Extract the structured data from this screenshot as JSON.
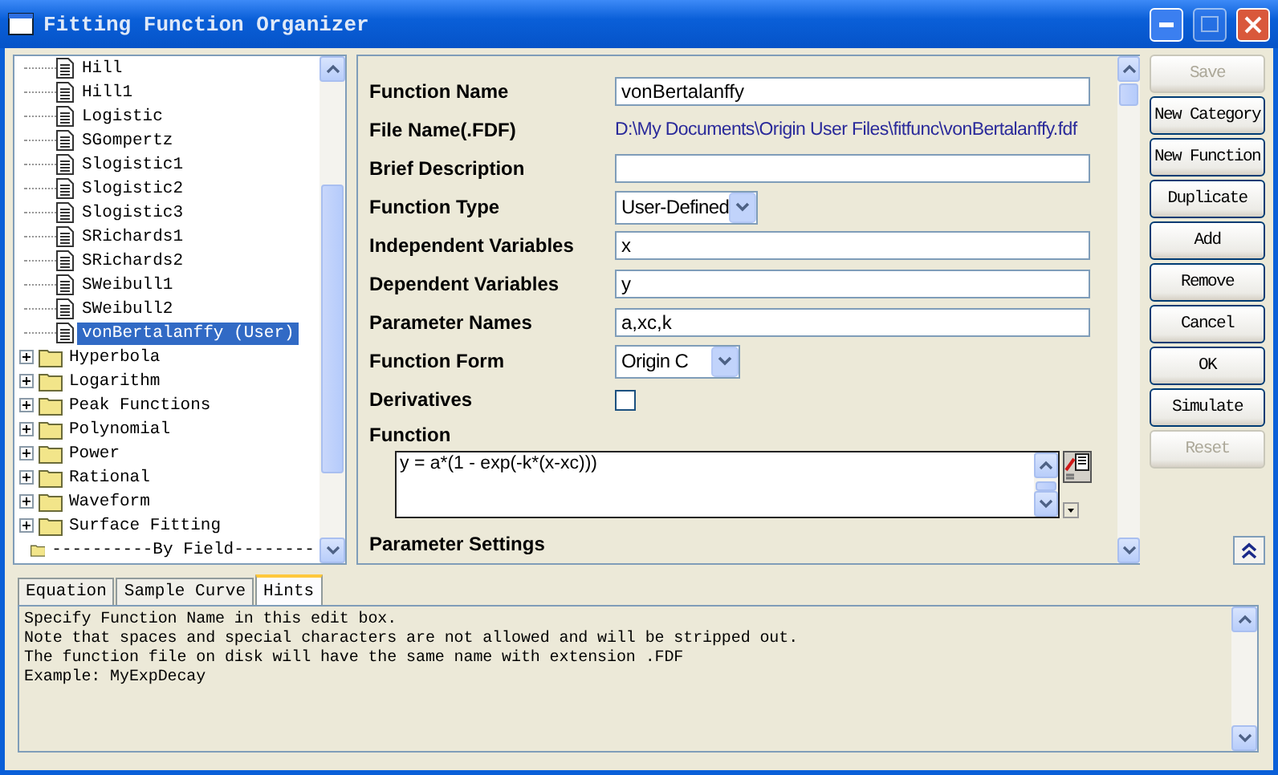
{
  "window": {
    "title": "Fitting Function Organizer"
  },
  "tree": [
    {
      "kind": "file",
      "label": "Hill",
      "selected": false
    },
    {
      "kind": "file",
      "label": "Hill1",
      "selected": false
    },
    {
      "kind": "file",
      "label": "Logistic",
      "selected": false
    },
    {
      "kind": "file",
      "label": "SGompertz",
      "selected": false
    },
    {
      "kind": "file",
      "label": "Slogistic1",
      "selected": false
    },
    {
      "kind": "file",
      "label": "Slogistic2",
      "selected": false
    },
    {
      "kind": "file",
      "label": "Slogistic3",
      "selected": false
    },
    {
      "kind": "file",
      "label": "SRichards1",
      "selected": false
    },
    {
      "kind": "file",
      "label": "SRichards2",
      "selected": false
    },
    {
      "kind": "file",
      "label": "SWeibull1",
      "selected": false
    },
    {
      "kind": "file",
      "label": "SWeibull2",
      "selected": false
    },
    {
      "kind": "file",
      "label": "vonBertalanffy (User)",
      "selected": true
    },
    {
      "kind": "folder",
      "label": "Hyperbola",
      "expanded": false,
      "selected": false
    },
    {
      "kind": "folder",
      "label": "Logarithm",
      "expanded": false,
      "selected": false
    },
    {
      "kind": "folder",
      "label": "Peak Functions",
      "expanded": false,
      "selected": false
    },
    {
      "kind": "folder",
      "label": "Polynomial",
      "expanded": false,
      "selected": false
    },
    {
      "kind": "folder",
      "label": "Power",
      "expanded": false,
      "selected": false
    },
    {
      "kind": "folder",
      "label": "Rational",
      "expanded": false,
      "selected": false
    },
    {
      "kind": "folder",
      "label": "Waveform",
      "expanded": false,
      "selected": false
    },
    {
      "kind": "folder",
      "label": "Surface Fitting",
      "expanded": false,
      "selected": false
    },
    {
      "kind": "separator",
      "label": "----------By Field--------",
      "selected": false
    }
  ],
  "form": [
    {
      "kind": "text",
      "label": "Function Name",
      "value": "vonBertalanffy"
    },
    {
      "kind": "path",
      "label": "File Name(.FDF)",
      "value": "D:\\My Documents\\Origin User Files\\fitfunc\\vonBertalanffy.fdf"
    },
    {
      "kind": "text",
      "label": "Brief Description"
    },
    {
      "kind": "select",
      "label": "Function Type",
      "value": "User-Defined"
    },
    {
      "kind": "text",
      "label": "Independent Variables",
      "value": "x"
    },
    {
      "kind": "text",
      "label": "Dependent Variables",
      "value": "y"
    },
    {
      "kind": "text",
      "label": "Parameter Names",
      "value": "a,xc,k"
    },
    {
      "kind": "select",
      "label": "Function Form",
      "value": "Origin C"
    },
    {
      "kind": "checkbox",
      "label": "Derivatives",
      "checked": false
    },
    {
      "kind": "code",
      "label": "Function",
      "value": "y = a*(1 - exp(-k*(x-xc)))"
    },
    {
      "kind": "heading",
      "label": "Parameter Settings"
    }
  ],
  "buttons": [
    {
      "label": "Save",
      "disabled": true
    },
    {
      "label": "New Category",
      "disabled": false
    },
    {
      "label": "New Function",
      "disabled": false
    },
    {
      "label": "Duplicate",
      "disabled": false
    },
    {
      "label": "Add",
      "disabled": false
    },
    {
      "label": "Remove",
      "disabled": false
    },
    {
      "label": "Cancel",
      "disabled": false
    },
    {
      "label": "OK",
      "disabled": false
    },
    {
      "label": "Simulate",
      "disabled": false
    },
    {
      "label": "Reset",
      "disabled": true
    }
  ],
  "tabs": [
    {
      "label": "Equation",
      "selected": false
    },
    {
      "label": "Sample Curve",
      "selected": false
    },
    {
      "label": "Hints",
      "selected": true
    }
  ],
  "hints": [
    "Specify Function Name in this edit box.",
    "Note that spaces and special characters are not allowed and will be stripped out.",
    "The function file on disk will have the same name with extension .FDF",
    "Example: MyExpDecay"
  ]
}
